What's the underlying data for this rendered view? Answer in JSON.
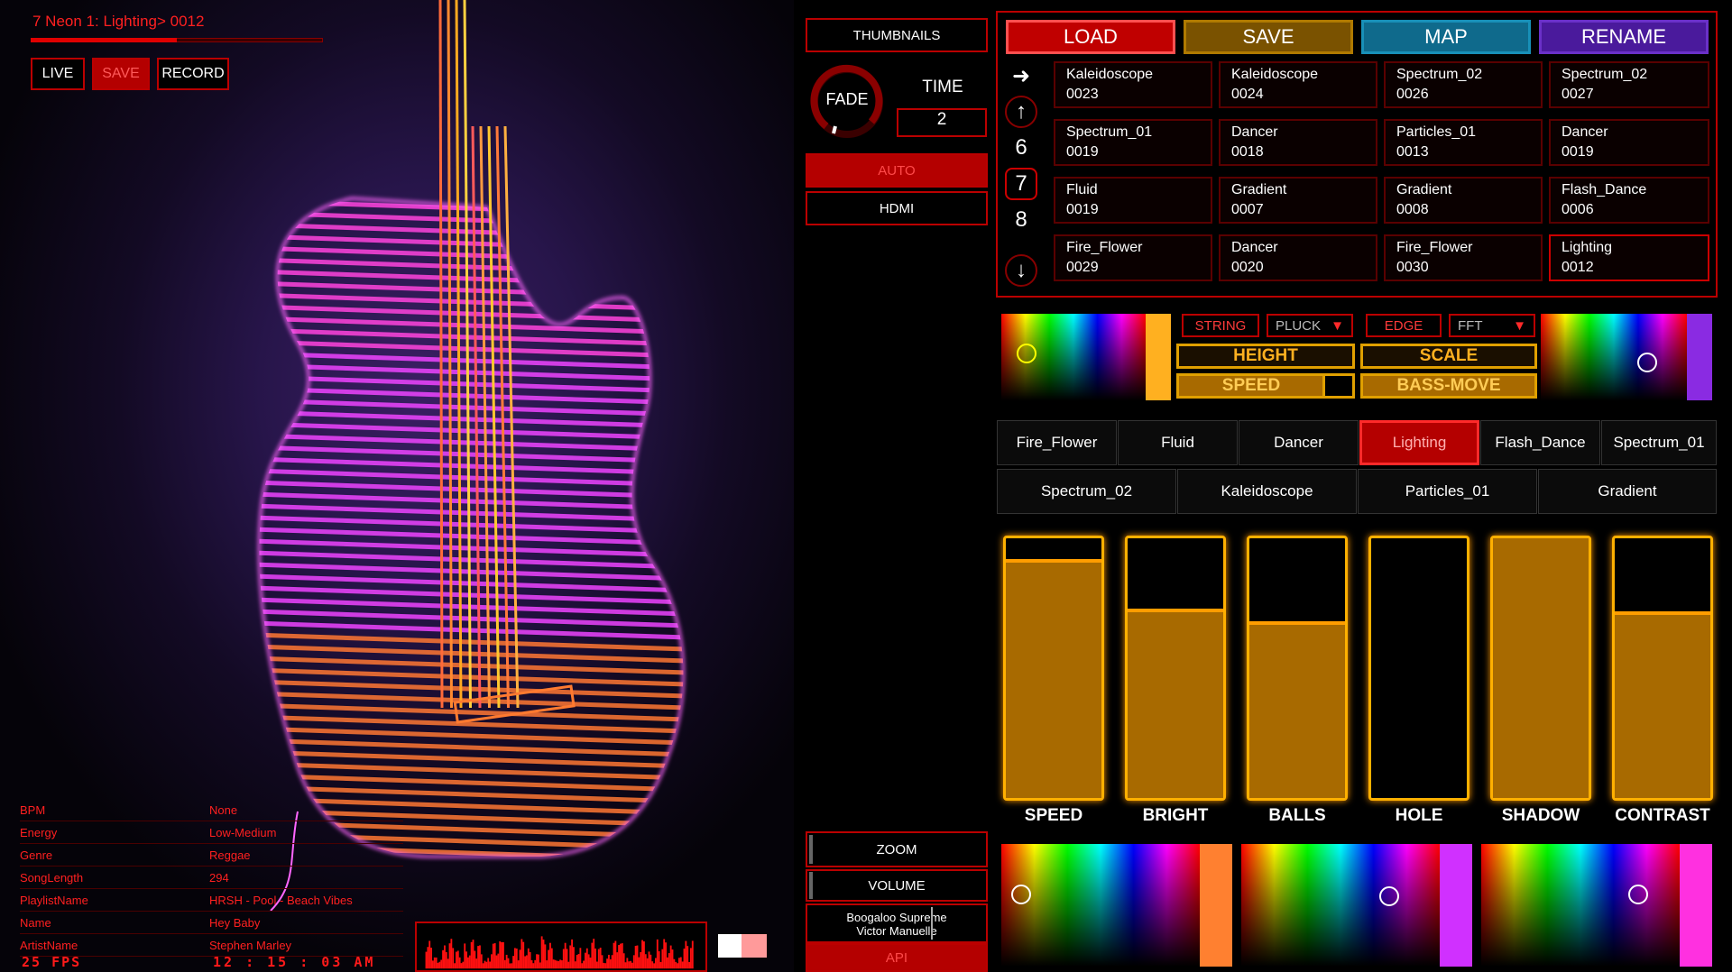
{
  "stage": {
    "title": "7 Neon 1: Lighting> 0012",
    "title_progress": 0.5,
    "buttons": [
      {
        "label": "LIVE",
        "active": false
      },
      {
        "label": "SAVE",
        "active": true
      },
      {
        "label": "RECORD",
        "active": false
      }
    ]
  },
  "info": [
    {
      "key": "BPM",
      "value": "None"
    },
    {
      "key": "Energy",
      "value": "Low-Medium"
    },
    {
      "key": "Genre",
      "value": "Reggae"
    },
    {
      "key": "SongLength",
      "value": "294"
    },
    {
      "key": "PlaylistName",
      "value": "HRSH - Pool - Beach Vibes"
    },
    {
      "key": "Name",
      "value": "Hey Baby"
    },
    {
      "key": "ArtistName",
      "value": "Stephen Marley"
    }
  ],
  "fps_text": "25 FPS",
  "clock": "12 : 15 : 03 AM",
  "middle": {
    "thumbnails": "THUMBNAILS",
    "fade": "FADE",
    "time_label": "TIME",
    "time_value": "2",
    "auto": "AUTO",
    "hdmi": "HDMI",
    "zoom": "ZOOM",
    "volume": "VOLUME",
    "song_line1": "Boogaloo Supreme",
    "song_line2": "Victor Manuelle",
    "api": "API"
  },
  "header_buttons": [
    {
      "label": "LOAD",
      "bg": "#c00000",
      "border": "#ff5050"
    },
    {
      "label": "SAVE",
      "bg": "#7a5200",
      "border": "#b07a00"
    },
    {
      "label": "MAP",
      "bg": "#0f6a8c",
      "border": "#1890b8"
    },
    {
      "label": "RENAME",
      "bg": "#4a1a9c",
      "border": "#6a30c8"
    }
  ],
  "pages": {
    "numbers": [
      "6",
      "7",
      "8"
    ],
    "selected": "7"
  },
  "grid": [
    [
      {
        "name": "Kaleidoscope",
        "id": "0023"
      },
      {
        "name": "Kaleidoscope",
        "id": "0024"
      },
      {
        "name": "Spectrum_02",
        "id": "0026"
      },
      {
        "name": "Spectrum_02",
        "id": "0027"
      }
    ],
    [
      {
        "name": "Spectrum_01",
        "id": "0019"
      },
      {
        "name": "Dancer",
        "id": "0018"
      },
      {
        "name": "Particles_01",
        "id": "0013"
      },
      {
        "name": "Dancer",
        "id": "0019"
      }
    ],
    [
      {
        "name": "Fluid",
        "id": "0019"
      },
      {
        "name": "Gradient",
        "id": "0007"
      },
      {
        "name": "Gradient",
        "id": "0008"
      },
      {
        "name": "Flash_Dance",
        "id": "0006"
      }
    ],
    [
      {
        "name": "Fire_Flower",
        "id": "0029"
      },
      {
        "name": "Dancer",
        "id": "0020"
      },
      {
        "name": "Fire_Flower",
        "id": "0030"
      },
      {
        "name": "Lighting",
        "id": "0012"
      }
    ]
  ],
  "controls": {
    "string": "STRING",
    "pluck": "PLUCK",
    "edge": "EDGE",
    "fft": "FFT",
    "height": "HEIGHT",
    "scale": "SCALE",
    "speed": "SPEED",
    "bass_move": "BASS-MOVE",
    "picker_left_color": "#ffb020",
    "picker_right_color": "#8a2be2"
  },
  "tabs_row1": [
    "Fire_Flower",
    "Fluid",
    "Dancer",
    "Lighting",
    "Flash_Dance",
    "Spectrum_01"
  ],
  "tabs_row2": [
    "Spectrum_02",
    "Kaleidoscope",
    "Particles_01",
    "Gradient"
  ],
  "selected_tab": "Lighting",
  "sliders": [
    {
      "label": "SPEED",
      "value": 0.92
    },
    {
      "label": "BRIGHT",
      "value": 0.73
    },
    {
      "label": "BALLS",
      "value": 0.68
    },
    {
      "label": "HOLE",
      "value": 0.0
    },
    {
      "label": "SHADOW",
      "value": 1.0
    },
    {
      "label": "CONTRAST",
      "value": 0.72
    }
  ],
  "bottom_pickers": [
    {
      "bar": "#ff8030"
    },
    {
      "bar": "#d030ff"
    },
    {
      "bar": "#ff30e0"
    }
  ]
}
